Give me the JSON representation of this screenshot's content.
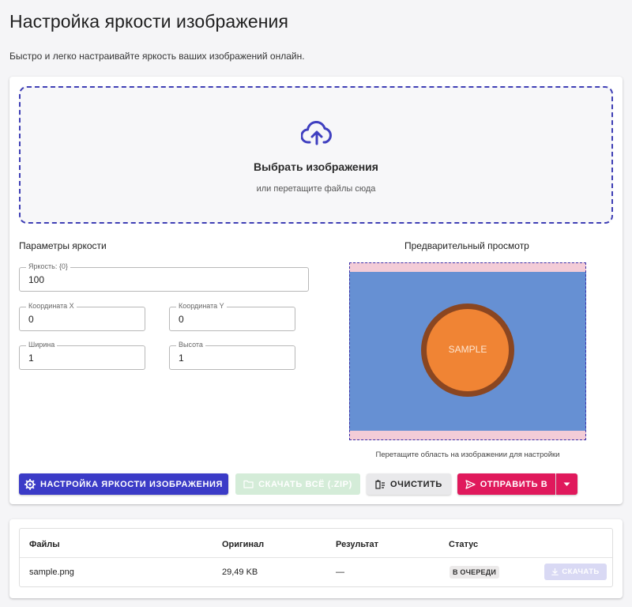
{
  "page": {
    "title": "Настройка яркости изображения",
    "subtitle": "Быстро и легко настраивайте яркость ваших изображений онлайн."
  },
  "dropzone": {
    "title": "Выбрать изображения",
    "hint": "или перетащите файлы сюда",
    "icon": "cloud-upload-icon"
  },
  "params": {
    "label": "Параметры яркости",
    "brightness": {
      "label": "Яркость: {0}",
      "value": "100"
    },
    "x": {
      "label": "Координата X",
      "value": "0"
    },
    "y": {
      "label": "Координата Y",
      "value": "0"
    },
    "width": {
      "label": "Ширина",
      "value": "1"
    },
    "height": {
      "label": "Высота",
      "value": "1"
    }
  },
  "preview": {
    "label": "Предварительный просмотр",
    "sample_text": "SAMPLE",
    "hint": "Перетащите область на изображении для настройки"
  },
  "actions": {
    "adjust": "Настройка яркости изображения",
    "download_all": "Скачать всё (.zip)",
    "clear": "Очистить",
    "send": "Отправить в"
  },
  "files": {
    "headers": {
      "files": "Файлы",
      "original": "Оригинал",
      "result": "Результат",
      "status": "Статус"
    },
    "rows": [
      {
        "name": "sample.png",
        "original": "29,49 KB",
        "result": "—",
        "status": "В очереди",
        "download": "Скачать"
      }
    ]
  },
  "colors": {
    "primary": "#3b3bc7",
    "accent": "#e0195c",
    "success_disabled": "#d4ecd8",
    "preview_bg": "#6690d3",
    "sample_fill": "#f08434"
  }
}
